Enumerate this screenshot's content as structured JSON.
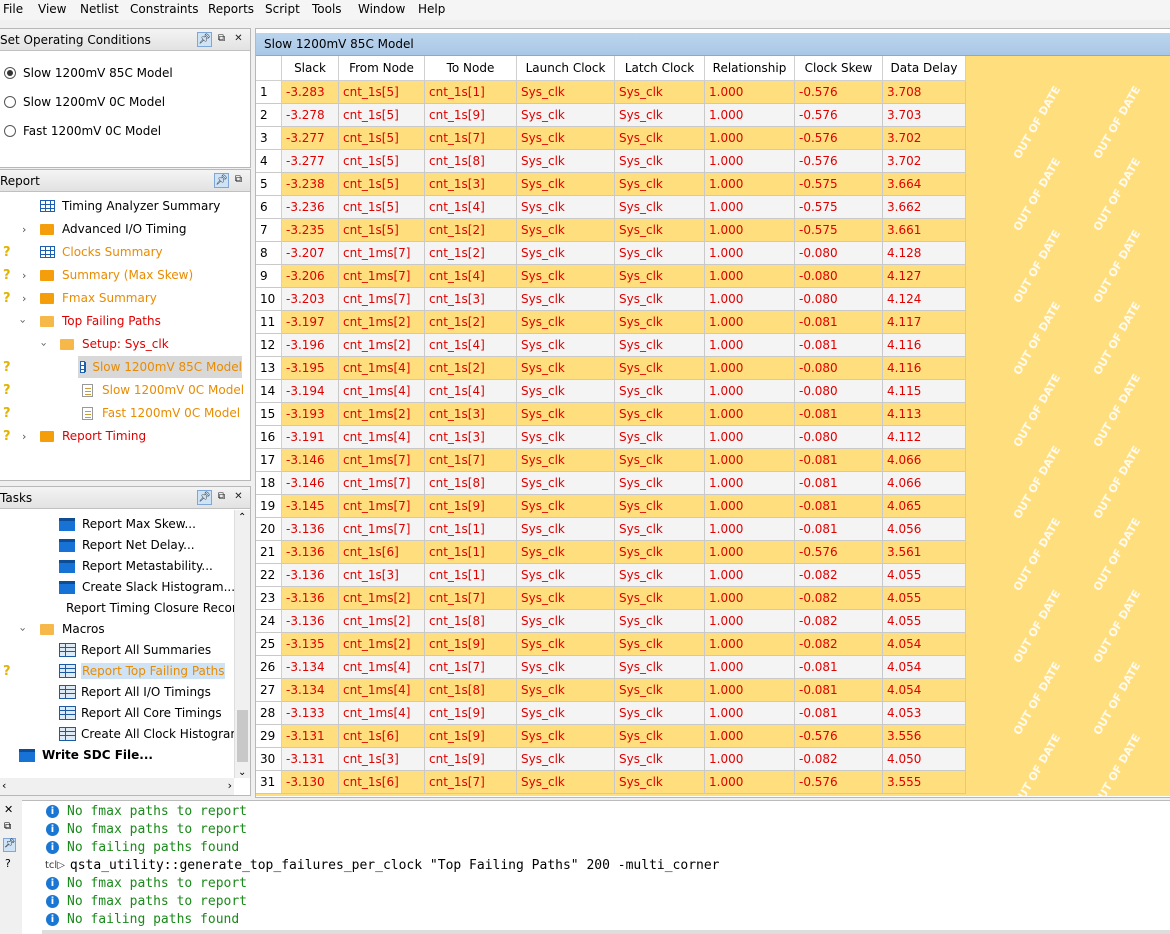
{
  "menu": [
    "File",
    "View",
    "Netlist",
    "Constraints",
    "Reports",
    "Script",
    "Tools",
    "Window",
    "Help"
  ],
  "op_conditions": {
    "title": "Set Operating Conditions",
    "options": [
      "Slow 1200mV 85C Model",
      "Slow 1200mV 0C Model",
      "Fast 1200mV 0C Model"
    ],
    "selected": "Slow 1200mV 85C Model"
  },
  "report": {
    "title": "Report",
    "items": [
      {
        "label": "Timing Analyzer Summary"
      },
      {
        "label": "Advanced I/O Timing"
      },
      {
        "label": "Clocks Summary"
      },
      {
        "label": "Summary (Max Skew)"
      },
      {
        "label": "Fmax Summary"
      },
      {
        "label": "Top Failing Paths"
      },
      {
        "label": "Setup: Sys_clk"
      },
      {
        "label": "Slow 1200mV 85C Model"
      },
      {
        "label": "Slow 1200mV 0C Model"
      },
      {
        "label": "Fast 1200mV 0C Model"
      },
      {
        "label": "Report Timing"
      }
    ]
  },
  "tasks": {
    "title": "Tasks",
    "items": [
      {
        "label": "Report Max Skew..."
      },
      {
        "label": "Report Net Delay..."
      },
      {
        "label": "Report Metastability..."
      },
      {
        "label": "Create Slack Histogram..."
      },
      {
        "label": "Report Timing Closure Recor"
      },
      {
        "label": "Macros"
      },
      {
        "label": "Report All Summaries"
      },
      {
        "label": "Report Top Failing Paths"
      },
      {
        "label": "Report All I/O Timings"
      },
      {
        "label": "Report All Core Timings"
      },
      {
        "label": "Create All Clock Histograms"
      },
      {
        "label": "Write SDC File..."
      }
    ]
  },
  "table": {
    "title": "Slow 1200mV 85C Model",
    "columns": [
      "Slack",
      "From Node",
      "To Node",
      "Launch Clock",
      "Latch Clock",
      "Relationship",
      "Clock Skew",
      "Data Delay"
    ],
    "watermark": "OUT OF DATE",
    "rows": [
      [
        "1",
        "-3.283",
        "cnt_1s[5]",
        "cnt_1s[1]",
        "Sys_clk",
        "Sys_clk",
        "1.000",
        "-0.576",
        "3.708"
      ],
      [
        "2",
        "-3.278",
        "cnt_1s[5]",
        "cnt_1s[9]",
        "Sys_clk",
        "Sys_clk",
        "1.000",
        "-0.576",
        "3.703"
      ],
      [
        "3",
        "-3.277",
        "cnt_1s[5]",
        "cnt_1s[7]",
        "Sys_clk",
        "Sys_clk",
        "1.000",
        "-0.576",
        "3.702"
      ],
      [
        "4",
        "-3.277",
        "cnt_1s[5]",
        "cnt_1s[8]",
        "Sys_clk",
        "Sys_clk",
        "1.000",
        "-0.576",
        "3.702"
      ],
      [
        "5",
        "-3.238",
        "cnt_1s[5]",
        "cnt_1s[3]",
        "Sys_clk",
        "Sys_clk",
        "1.000",
        "-0.575",
        "3.664"
      ],
      [
        "6",
        "-3.236",
        "cnt_1s[5]",
        "cnt_1s[4]",
        "Sys_clk",
        "Sys_clk",
        "1.000",
        "-0.575",
        "3.662"
      ],
      [
        "7",
        "-3.235",
        "cnt_1s[5]",
        "cnt_1s[2]",
        "Sys_clk",
        "Sys_clk",
        "1.000",
        "-0.575",
        "3.661"
      ],
      [
        "8",
        "-3.207",
        "cnt_1ms[7]",
        "cnt_1s[2]",
        "Sys_clk",
        "Sys_clk",
        "1.000",
        "-0.080",
        "4.128"
      ],
      [
        "9",
        "-3.206",
        "cnt_1ms[7]",
        "cnt_1s[4]",
        "Sys_clk",
        "Sys_clk",
        "1.000",
        "-0.080",
        "4.127"
      ],
      [
        "10",
        "-3.203",
        "cnt_1ms[7]",
        "cnt_1s[3]",
        "Sys_clk",
        "Sys_clk",
        "1.000",
        "-0.080",
        "4.124"
      ],
      [
        "11",
        "-3.197",
        "cnt_1ms[2]",
        "cnt_1s[2]",
        "Sys_clk",
        "Sys_clk",
        "1.000",
        "-0.081",
        "4.117"
      ],
      [
        "12",
        "-3.196",
        "cnt_1ms[2]",
        "cnt_1s[4]",
        "Sys_clk",
        "Sys_clk",
        "1.000",
        "-0.081",
        "4.116"
      ],
      [
        "13",
        "-3.195",
        "cnt_1ms[4]",
        "cnt_1s[2]",
        "Sys_clk",
        "Sys_clk",
        "1.000",
        "-0.080",
        "4.116"
      ],
      [
        "14",
        "-3.194",
        "cnt_1ms[4]",
        "cnt_1s[4]",
        "Sys_clk",
        "Sys_clk",
        "1.000",
        "-0.080",
        "4.115"
      ],
      [
        "15",
        "-3.193",
        "cnt_1ms[2]",
        "cnt_1s[3]",
        "Sys_clk",
        "Sys_clk",
        "1.000",
        "-0.081",
        "4.113"
      ],
      [
        "16",
        "-3.191",
        "cnt_1ms[4]",
        "cnt_1s[3]",
        "Sys_clk",
        "Sys_clk",
        "1.000",
        "-0.080",
        "4.112"
      ],
      [
        "17",
        "-3.146",
        "cnt_1ms[7]",
        "cnt_1s[7]",
        "Sys_clk",
        "Sys_clk",
        "1.000",
        "-0.081",
        "4.066"
      ],
      [
        "18",
        "-3.146",
        "cnt_1ms[7]",
        "cnt_1s[8]",
        "Sys_clk",
        "Sys_clk",
        "1.000",
        "-0.081",
        "4.066"
      ],
      [
        "19",
        "-3.145",
        "cnt_1ms[7]",
        "cnt_1s[9]",
        "Sys_clk",
        "Sys_clk",
        "1.000",
        "-0.081",
        "4.065"
      ],
      [
        "20",
        "-3.136",
        "cnt_1ms[7]",
        "cnt_1s[1]",
        "Sys_clk",
        "Sys_clk",
        "1.000",
        "-0.081",
        "4.056"
      ],
      [
        "21",
        "-3.136",
        "cnt_1s[6]",
        "cnt_1s[1]",
        "Sys_clk",
        "Sys_clk",
        "1.000",
        "-0.576",
        "3.561"
      ],
      [
        "22",
        "-3.136",
        "cnt_1s[3]",
        "cnt_1s[1]",
        "Sys_clk",
        "Sys_clk",
        "1.000",
        "-0.082",
        "4.055"
      ],
      [
        "23",
        "-3.136",
        "cnt_1ms[2]",
        "cnt_1s[7]",
        "Sys_clk",
        "Sys_clk",
        "1.000",
        "-0.082",
        "4.055"
      ],
      [
        "24",
        "-3.136",
        "cnt_1ms[2]",
        "cnt_1s[8]",
        "Sys_clk",
        "Sys_clk",
        "1.000",
        "-0.082",
        "4.055"
      ],
      [
        "25",
        "-3.135",
        "cnt_1ms[2]",
        "cnt_1s[9]",
        "Sys_clk",
        "Sys_clk",
        "1.000",
        "-0.082",
        "4.054"
      ],
      [
        "26",
        "-3.134",
        "cnt_1ms[4]",
        "cnt_1s[7]",
        "Sys_clk",
        "Sys_clk",
        "1.000",
        "-0.081",
        "4.054"
      ],
      [
        "27",
        "-3.134",
        "cnt_1ms[4]",
        "cnt_1s[8]",
        "Sys_clk",
        "Sys_clk",
        "1.000",
        "-0.081",
        "4.054"
      ],
      [
        "28",
        "-3.133",
        "cnt_1ms[4]",
        "cnt_1s[9]",
        "Sys_clk",
        "Sys_clk",
        "1.000",
        "-0.081",
        "4.053"
      ],
      [
        "29",
        "-3.131",
        "cnt_1s[6]",
        "cnt_1s[9]",
        "Sys_clk",
        "Sys_clk",
        "1.000",
        "-0.576",
        "3.556"
      ],
      [
        "30",
        "-3.131",
        "cnt_1s[3]",
        "cnt_1s[9]",
        "Sys_clk",
        "Sys_clk",
        "1.000",
        "-0.082",
        "4.050"
      ],
      [
        "31",
        "-3.130",
        "cnt_1s[6]",
        "cnt_1s[7]",
        "Sys_clk",
        "Sys_clk",
        "1.000",
        "-0.576",
        "3.555"
      ]
    ]
  },
  "console": {
    "lines": [
      {
        "kind": "info",
        "text": "No fmax paths to report"
      },
      {
        "kind": "info",
        "text": "No fmax paths to report"
      },
      {
        "kind": "info",
        "text": "No failing paths found"
      },
      {
        "kind": "tcl",
        "prefix": "tcl▷",
        "text": "qsta_utility::generate_top_failures_per_clock \"Top Failing Paths\" 200 -multi_corner"
      },
      {
        "kind": "info",
        "text": "No fmax paths to report"
      },
      {
        "kind": "info",
        "text": "No fmax paths to report"
      },
      {
        "kind": "info",
        "text": "No failing paths found"
      }
    ]
  },
  "colors": {
    "failing_red": "#e00000",
    "row_yellow": "#ffde7d",
    "warning_orange": "#e98b00",
    "info_green": "#1a8a1a"
  }
}
